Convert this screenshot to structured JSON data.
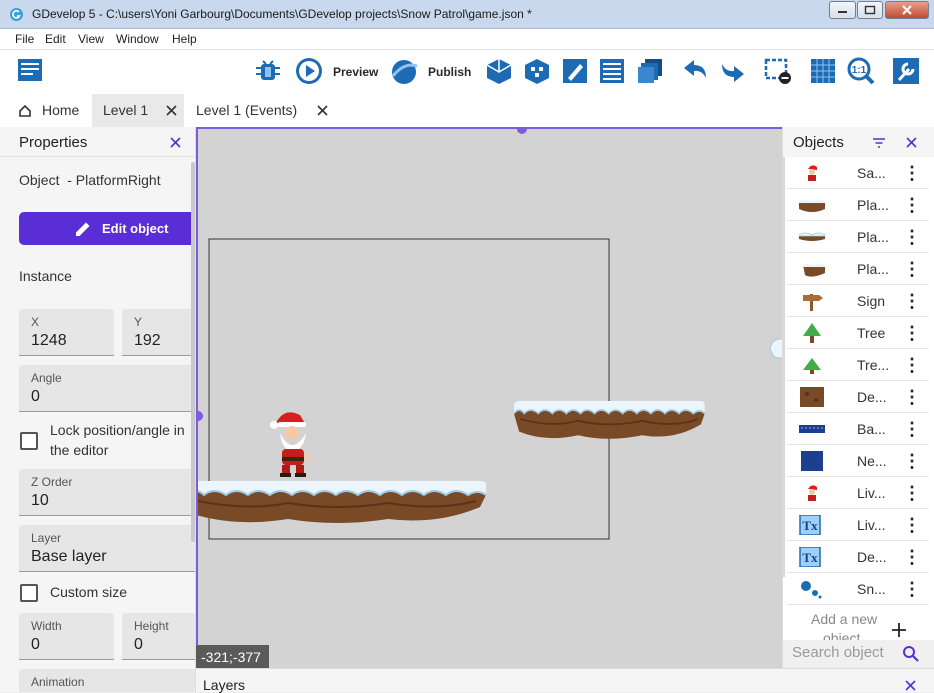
{
  "window": {
    "title": "GDevelop 5 - C:\\users\\Yoni Garbourg\\Documents\\GDevelop projects\\Snow Patrol\\game.json *"
  },
  "menubar": {
    "items": [
      "File",
      "Edit",
      "View",
      "Window",
      "Help"
    ]
  },
  "toolbar": {
    "preview_label": "Preview",
    "publish_label": "Publish"
  },
  "tabs": [
    {
      "label": "Home"
    },
    {
      "label": "Level 1"
    },
    {
      "label": "Level 1 (Events)"
    }
  ],
  "properties": {
    "title": "Properties",
    "object_label": "Object  - PlatformRight",
    "edit_button": "Edit object",
    "instance_label": "Instance",
    "x": {
      "label": "X",
      "value": "1248"
    },
    "y": {
      "label": "Y",
      "value": "192"
    },
    "angle": {
      "label": "Angle",
      "value": "0"
    },
    "lock_label_1": "Lock position/angle in",
    "lock_label_2": "the editor",
    "zorder": {
      "label": "Z Order",
      "value": "10"
    },
    "layer": {
      "label": "Layer",
      "value": "Base layer"
    },
    "custom_size_label": "Custom size",
    "width": {
      "label": "Width",
      "value": "0"
    },
    "height": {
      "label": "Height",
      "value": "0"
    },
    "animation_label": "Animation"
  },
  "scene": {
    "coords": "-321;-377"
  },
  "objects_panel": {
    "title": "Objects",
    "items": [
      {
        "name": "Sa...",
        "icon": "santa"
      },
      {
        "name": "Pla...",
        "icon": "platform"
      },
      {
        "name": "Pla...",
        "icon": "platform-snow"
      },
      {
        "name": "Pla...",
        "icon": "platform-right"
      },
      {
        "name": "Sign",
        "icon": "sign"
      },
      {
        "name": "Tree",
        "icon": "tree"
      },
      {
        "name": "Tre...",
        "icon": "tree-small"
      },
      {
        "name": "De...",
        "icon": "dirt"
      },
      {
        "name": "Ba...",
        "icon": "bar"
      },
      {
        "name": "Ne...",
        "icon": "navy-square"
      },
      {
        "name": "Liv...",
        "icon": "santa"
      },
      {
        "name": "Liv...",
        "icon": "text"
      },
      {
        "name": "De...",
        "icon": "text"
      },
      {
        "name": "Sn...",
        "icon": "snow-particles"
      }
    ],
    "add_new_1": "Add a new",
    "add_new_2": "object",
    "search_placeholder": "Search object"
  },
  "layers": {
    "title": "Layers"
  },
  "colors": {
    "accent": "#5a2ed6",
    "selection": "#7e5bdb",
    "toolbar_blue": "#1d6bb5"
  }
}
